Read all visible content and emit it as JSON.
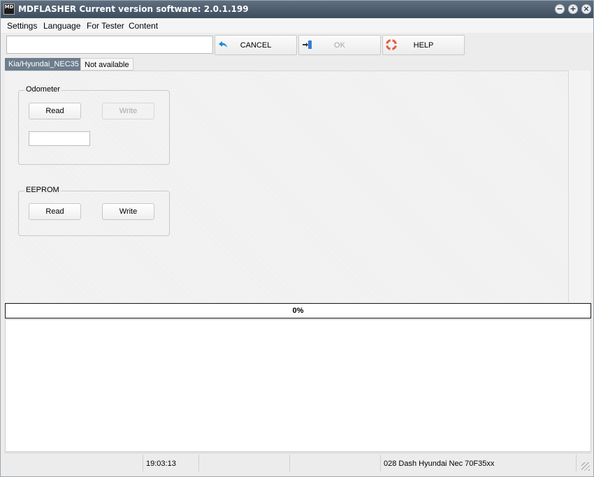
{
  "window": {
    "app_icon": "MD",
    "title": "MDFLASHER  Current version software: 2.0.1.199",
    "controls": {
      "minimize": "−",
      "maximize": "+",
      "close": "×"
    }
  },
  "menu": [
    "Settings",
    "Language",
    "For Tester",
    "Content"
  ],
  "toolbar": {
    "input_value": "",
    "cancel_label": "CANCEL",
    "ok_label": "OK",
    "help_label": "HELP",
    "icons": {
      "cancel": "undo-arrow-icon",
      "ok": "enter-door-icon",
      "help": "lifebuoy-icon"
    },
    "colors": {
      "cancel_icon": "#1e88d8",
      "help_icon": "#e25b3f",
      "ok_icon": "#3a7bd5"
    }
  },
  "tabs": [
    {
      "label": "Kia/Hyundai_NEC35",
      "active": true
    },
    {
      "label": "Not available",
      "active": false
    }
  ],
  "odometer": {
    "title": "Odometer",
    "read_label": "Read",
    "write_label": "Write",
    "value": ""
  },
  "eeprom": {
    "title": "EEPROM",
    "read_label": "Read",
    "write_label": "Write"
  },
  "progress": {
    "value": 0,
    "text": "0%"
  },
  "statusbar": {
    "time": "19:03:13",
    "device": "028 Dash Hyundai Nec 70F35xx"
  }
}
